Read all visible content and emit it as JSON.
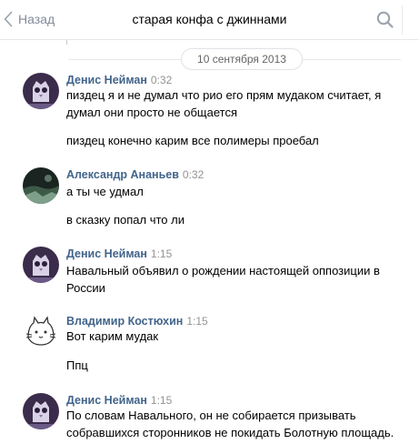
{
  "header": {
    "back_label": "Назад",
    "title": "старая конфа с джиннами"
  },
  "date_separator": "10 сентября 2013",
  "messages": [
    {
      "author": "Денис Нейман",
      "time": "0:32",
      "avatar": "denis",
      "lines": [
        "пиздец я и не думал что рио его прям мудаком считает, я думал они просто не общается",
        "пиздец конечно карим все полимеры проебал"
      ]
    },
    {
      "author": "Александр Ананьев",
      "time": "0:32",
      "avatar": "alexander",
      "lines": [
        "а ты че удмал",
        "в сказку попал что ли"
      ]
    },
    {
      "author": "Денис Нейман",
      "time": "1:15",
      "avatar": "denis",
      "lines": [
        "Навальный объявил о рождении настоящей оппозиции в России"
      ]
    },
    {
      "author": "Владимир Костюхин",
      "time": "1:15",
      "avatar": "vladimir",
      "lines": [
        "Вот карим мудак",
        "Ппц"
      ]
    },
    {
      "author": "Денис Нейман",
      "time": "1:15",
      "avatar": "denis",
      "lines": [
        "По словам Навального, он не собирается призывать собравшихся сторонников не покидать Болотную площадь."
      ]
    }
  ]
}
